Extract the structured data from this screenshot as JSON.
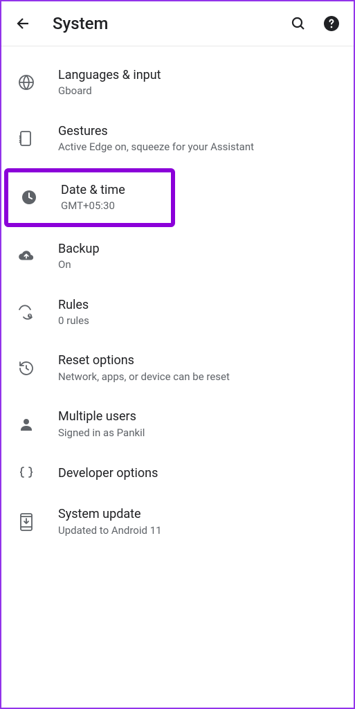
{
  "header": {
    "title": "System"
  },
  "items": [
    {
      "title": "Languages & input",
      "subtitle": "Gboard"
    },
    {
      "title": "Gestures",
      "subtitle": "Active Edge on, squeeze for your Assistant"
    },
    {
      "title": "Date & time",
      "subtitle": "GMT+05:30"
    },
    {
      "title": "Backup",
      "subtitle": "On"
    },
    {
      "title": "Rules",
      "subtitle": "0 rules"
    },
    {
      "title": "Reset options",
      "subtitle": "Network, apps, or device can be reset"
    },
    {
      "title": "Multiple users",
      "subtitle": "Signed in as Pankil"
    },
    {
      "title": "Developer options",
      "subtitle": ""
    },
    {
      "title": "System update",
      "subtitle": "Updated to Android 11"
    }
  ]
}
